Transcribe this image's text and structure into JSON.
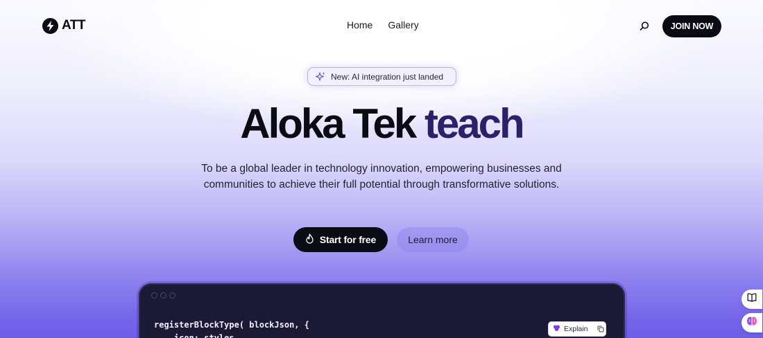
{
  "nav": {
    "logo_text": "ATT",
    "links": [
      "Home",
      "Gallery"
    ],
    "join_label": "JOIN NOW"
  },
  "hero": {
    "badge": "New: AI integration just landed",
    "title_main": "Aloka Tek ",
    "title_accent": "teach",
    "description": "To be a global leader in technology innovation, empowering businesses and communities to achieve their full potential through transformative solutions.",
    "cta_primary": "Start for free",
    "cta_secondary": "Learn more"
  },
  "code_window": {
    "lines": [
      "registerBlockType( blockJson, {",
      "    icon: styles,"
    ],
    "explain_label": "Explain"
  },
  "icons": {
    "logo": "bolt-icon",
    "search": "search-icon",
    "badge": "sparkle-icon",
    "cta": "flame-icon",
    "copy": "copy-icon",
    "side_1": "book-icon",
    "side_2": "brain-icon"
  },
  "colors": {
    "brand_dark": "#0b0b14",
    "accent_title": "#2a2168",
    "code_bg": "#1b1934"
  }
}
